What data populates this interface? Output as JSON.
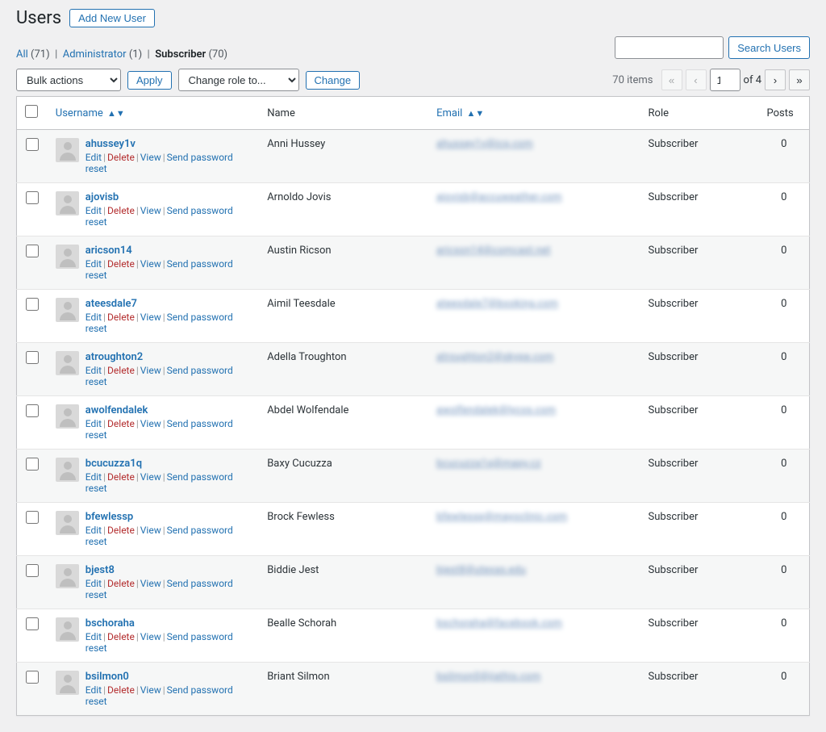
{
  "page_title": "Users",
  "add_new_label": "Add New User",
  "filters": {
    "all_label": "All",
    "all_count": "(71)",
    "admin_label": "Administrator",
    "admin_count": "(1)",
    "subscriber_label": "Subscriber",
    "subscriber_count": "(70)"
  },
  "bulk": {
    "bulk_label": "Bulk actions",
    "apply_label": "Apply",
    "role_label": "Change role to...",
    "change_label": "Change"
  },
  "search": {
    "placeholder": "",
    "button": "Search Users"
  },
  "pagination": {
    "items_text": "70 items",
    "current_page": "1",
    "of_text": "of 4"
  },
  "columns": {
    "username": "Username",
    "name": "Name",
    "email": "Email",
    "role": "Role",
    "posts": "Posts"
  },
  "row_actions": {
    "edit": "Edit",
    "delete": "Delete",
    "view": "View",
    "reset": "Send password reset"
  },
  "rows": [
    {
      "username": "ahussey1v",
      "name": "Anni Hussey",
      "email": "ahussey1v@icq.com",
      "role": "Subscriber",
      "posts": "0"
    },
    {
      "username": "ajovisb",
      "name": "Arnoldo Jovis",
      "email": "ajovisb@accuweather.com",
      "role": "Subscriber",
      "posts": "0"
    },
    {
      "username": "aricson14",
      "name": "Austin Ricson",
      "email": "aricson14@comcast.net",
      "role": "Subscriber",
      "posts": "0"
    },
    {
      "username": "ateesdale7",
      "name": "Aimil Teesdale",
      "email": "ateesdale7@booking.com",
      "role": "Subscriber",
      "posts": "0"
    },
    {
      "username": "atroughton2",
      "name": "Adella Troughton",
      "email": "atroughton2@skype.com",
      "role": "Subscriber",
      "posts": "0"
    },
    {
      "username": "awolfendalek",
      "name": "Abdel Wolfendale",
      "email": "awolfendalek@lycos.com",
      "role": "Subscriber",
      "posts": "0"
    },
    {
      "username": "bcucuzza1q",
      "name": "Baxy Cucuzza",
      "email": "bcucuzza1q@mapy.cz",
      "role": "Subscriber",
      "posts": "0"
    },
    {
      "username": "bfewlessp",
      "name": "Brock Fewless",
      "email": "bfewlessp@mayoclinic.com",
      "role": "Subscriber",
      "posts": "0"
    },
    {
      "username": "bjest8",
      "name": "Biddie Jest",
      "email": "bjest8@utexas.edu",
      "role": "Subscriber",
      "posts": "0"
    },
    {
      "username": "bschoraha",
      "name": "Bealle Schorah",
      "email": "bschoraha@facebook.com",
      "role": "Subscriber",
      "posts": "0"
    },
    {
      "username": "bsilmon0",
      "name": "Briant Silmon",
      "email": "bsilmon0@jiathis.com",
      "role": "Subscriber",
      "posts": "0"
    }
  ]
}
